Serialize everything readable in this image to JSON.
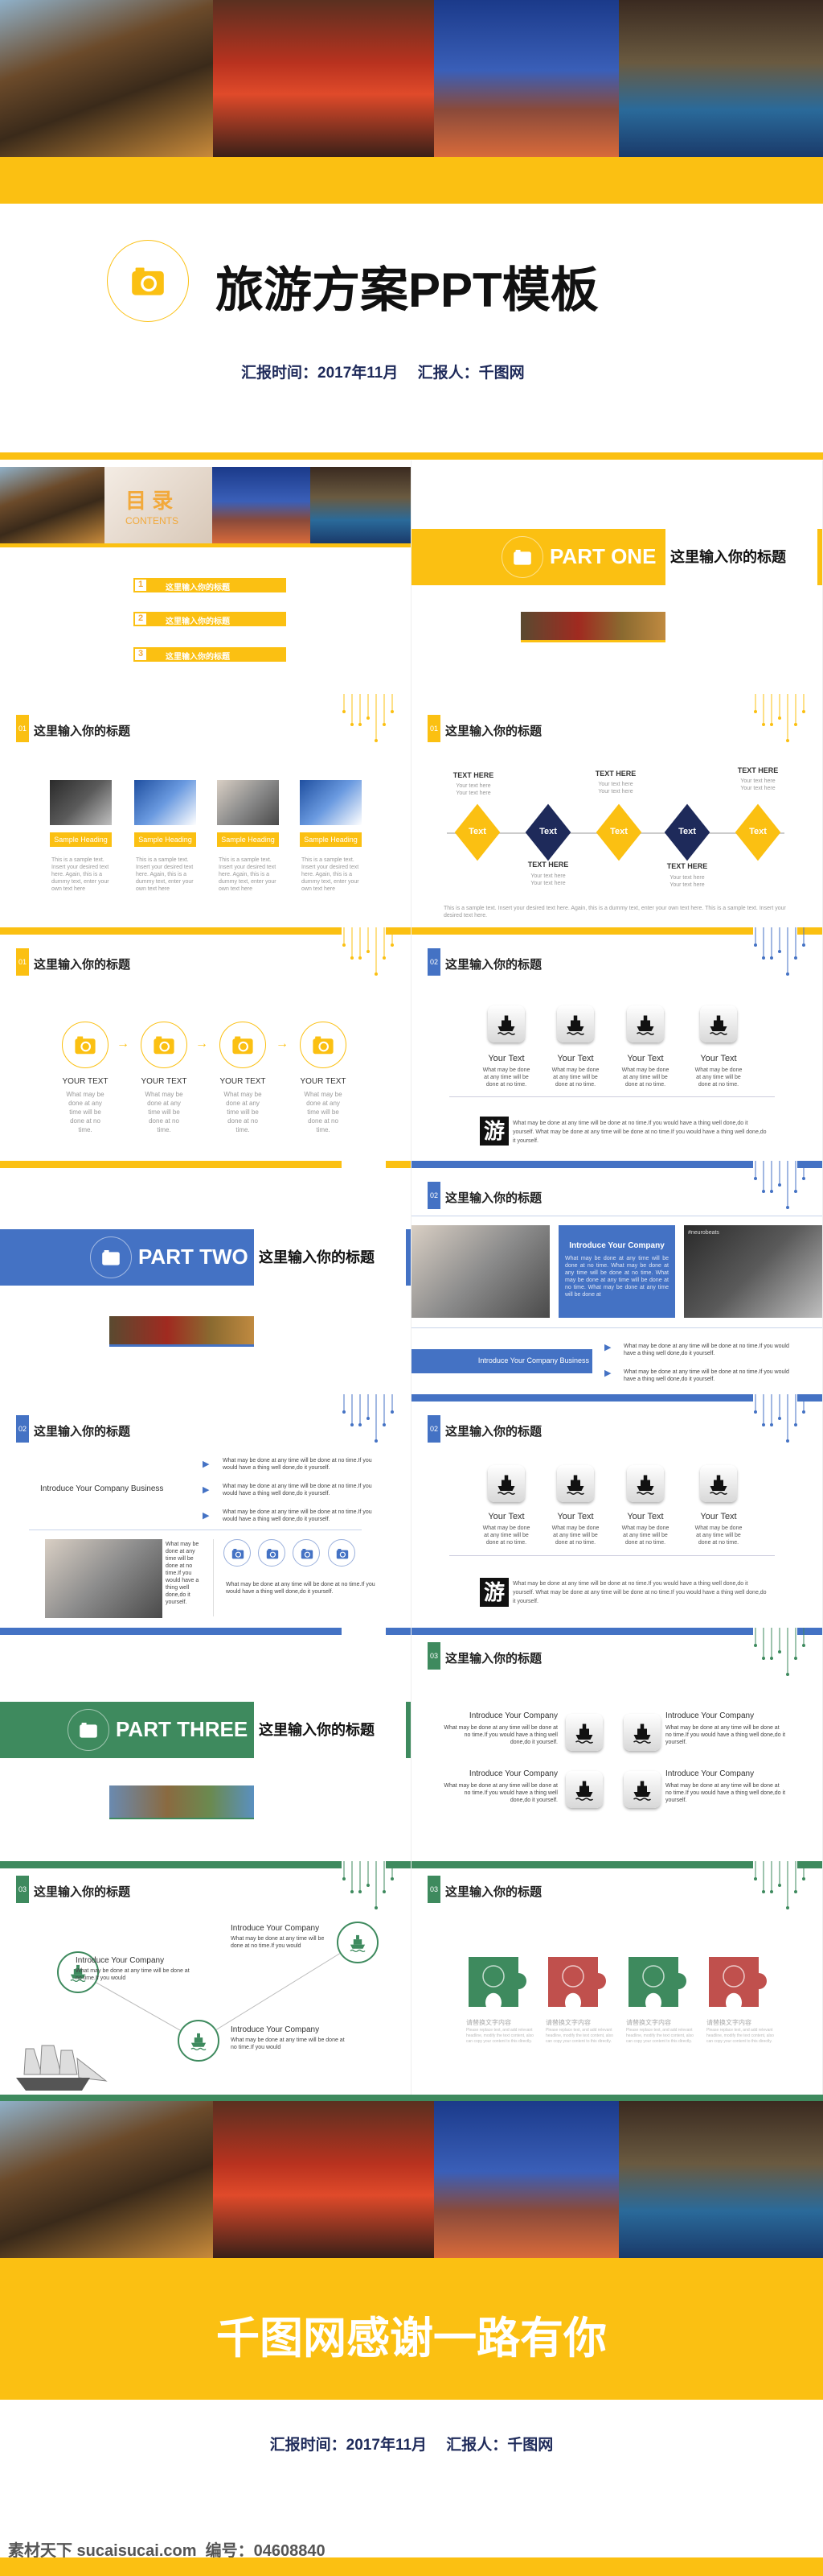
{
  "cover": {
    "title": "旅游方案PPT模板",
    "subtitle": "汇报时间：2017年11月　 汇报人：千图网"
  },
  "toc": {
    "title": "目 录",
    "subtitle": "CONTENTS",
    "items": [
      {
        "num": "1",
        "label": "这里输入你的标题"
      },
      {
        "num": "2",
        "label": "这里输入你的标题"
      },
      {
        "num": "3",
        "label": "这里输入你的标题"
      }
    ]
  },
  "parts": [
    {
      "label": "PART ONE",
      "title": "这里输入你的标题"
    },
    {
      "label": "PART TWO",
      "title": "这里输入你的标题"
    },
    {
      "label": "PART THREE",
      "title": "这里输入你的标题"
    }
  ],
  "slide_title": "这里输入你的标题",
  "numbers": [
    "01",
    "02",
    "03"
  ],
  "cards": [
    {
      "heading": "Sample Heading",
      "body": "This is a sample text. Insert your desired text here. Again, this is a dummy text, enter your own text here"
    },
    {
      "heading": "Sample Heading",
      "body": "This is a sample text. Insert your desired text here. Again, this is a dummy text, enter your own text here"
    },
    {
      "heading": "Sample Heading",
      "body": "This is a sample text. Insert your desired text here. Again, this is a dummy text, enter your own text here"
    },
    {
      "heading": "Sample Heading",
      "body": "This is a sample text. Insert your desired text here. Again, this is a dummy text, enter your own text here"
    }
  ],
  "timeline": {
    "top": [
      {
        "heading": "TEXT HERE",
        "body": "Your text here Your text here"
      },
      {
        "heading": "TEXT HERE",
        "body": "Your text here Your text here"
      },
      {
        "heading": "TEXT HERE",
        "body": "Your text here Your text here"
      }
    ],
    "bottom": [
      {
        "heading": "TEXT HERE",
        "body": "Your text here Your text here"
      },
      {
        "heading": "TEXT HERE",
        "body": "Your text here Your text here"
      }
    ],
    "diamonds": [
      "Text",
      "Text",
      "Text",
      "Text",
      "Text"
    ],
    "note": "This is a sample text. Insert your desired text here. Again, this is a dummy text, enter your own text here. This is a sample text. Insert your desired text here."
  },
  "steps": [
    {
      "heading": "YOUR TEXT",
      "body": "What may be done at any time will be done at no time."
    },
    {
      "heading": "YOUR TEXT",
      "body": "What may be done at any time will be done at no time."
    },
    {
      "heading": "YOUR TEXT",
      "body": "What may be done at any time will be done at no time."
    },
    {
      "heading": "YOUR TEXT",
      "body": "What may be done at any time will be done at no time."
    }
  ],
  "icon_grid": {
    "items": [
      {
        "heading": "Your Text",
        "body": "What may be done at any time will be done at no time."
      },
      {
        "heading": "Your Text",
        "body": "What may be done at any time will be done at no time."
      },
      {
        "heading": "Your Text",
        "body": "What may be done at any time will be done at no time."
      },
      {
        "heading": "Your Text",
        "body": "What may be done at any time will be done at no time."
      }
    ],
    "badge": "游",
    "note": "What may be done at any time will be done at no time.If you would have a thing well done,do it yourself. What may be done at any time will be done at no time.If you would have a thing well done,do it yourself."
  },
  "company": {
    "heading": "Introduce Your Company",
    "body": "What may be done at any time will be done at no time. What may be done at any time will be done at no time. What may be done at any time will be done at no time. What may be done at any time will be done at",
    "photo_caption": "#neurobeats",
    "business": "Introduce Your Company Business",
    "points": [
      "What may be done at any time will be done at no time.If you would have a thing well done,do it yourself.",
      "What may be done at any time will be done at no time.If you would have a thing well done,do it yourself."
    ]
  },
  "business": {
    "label": "Introduce Your Company Business",
    "points": [
      "What may be done at any time will be done at no time.If you would have a thing well done,do it yourself.",
      "What may be done at any time will be done at no time.If you would have a thing well done,do it yourself.",
      "What may be done at any time will be done at no time.If you would have a thing well done,do it yourself."
    ],
    "side_text": "What may be done at any time will be done at no time.If you would have a thing well done,do it yourself.",
    "bottom_text": "What may be done at any time will be done at no time.If you would have a thing well done,do it yourself."
  },
  "company4": [
    {
      "heading": "Introduce Your Company",
      "body": "What may be done at any time will be done at no time.If you would have a thing well done,do it yourself."
    },
    {
      "heading": "Introduce Your Company",
      "body": "What may be done at any time will be done at no time.If you would have a thing well done,do it yourself."
    },
    {
      "heading": "Introduce Your Company",
      "body": "What may be done at any time will be done at no time.If you would have a thing well done,do it yourself."
    },
    {
      "heading": "Introduce Your Company",
      "body": "What may be done at any time will be done at no time.If you would have a thing well done,do it yourself."
    }
  ],
  "ships": [
    {
      "heading": "Introduce Your Company",
      "body": "What may be done at any time will be done at no time.If you would"
    },
    {
      "heading": "Introduce Your Company",
      "body": "What may be done at any time will be done at no time.If you would"
    },
    {
      "heading": "Introduce Your Company",
      "body": "What may be done at any time will be done at no time.If you would"
    }
  ],
  "puzzle": [
    {
      "heading": "请替换文字内容",
      "body": "Please replace text, and add relevant headline, modify the text content, also can copy your content to this directly."
    },
    {
      "heading": "请替换文字内容",
      "body": "Please replace text, and add relevant headline, modify the text content, also can copy your content to this directly."
    },
    {
      "heading": "请替换文字内容",
      "body": "Please replace text, and add relevant headline, modify the text content, also can copy your content to this directly."
    },
    {
      "heading": "请替换文字内容",
      "body": "Please replace text, and add relevant headline, modify the text content, also can copy your content to this directly."
    }
  ],
  "ending": {
    "title": "千图网感谢一路有你",
    "subtitle": "汇报时间：2017年11月　 汇报人：千图网"
  },
  "watermark": "素材天下 sucaisucai.com  编号：04608840",
  "colors": {
    "yellow": "#FBC012",
    "blue": "#4472C4",
    "green": "#3E8A5E",
    "red": "#C0504D",
    "navy": "#1E2A5A"
  }
}
